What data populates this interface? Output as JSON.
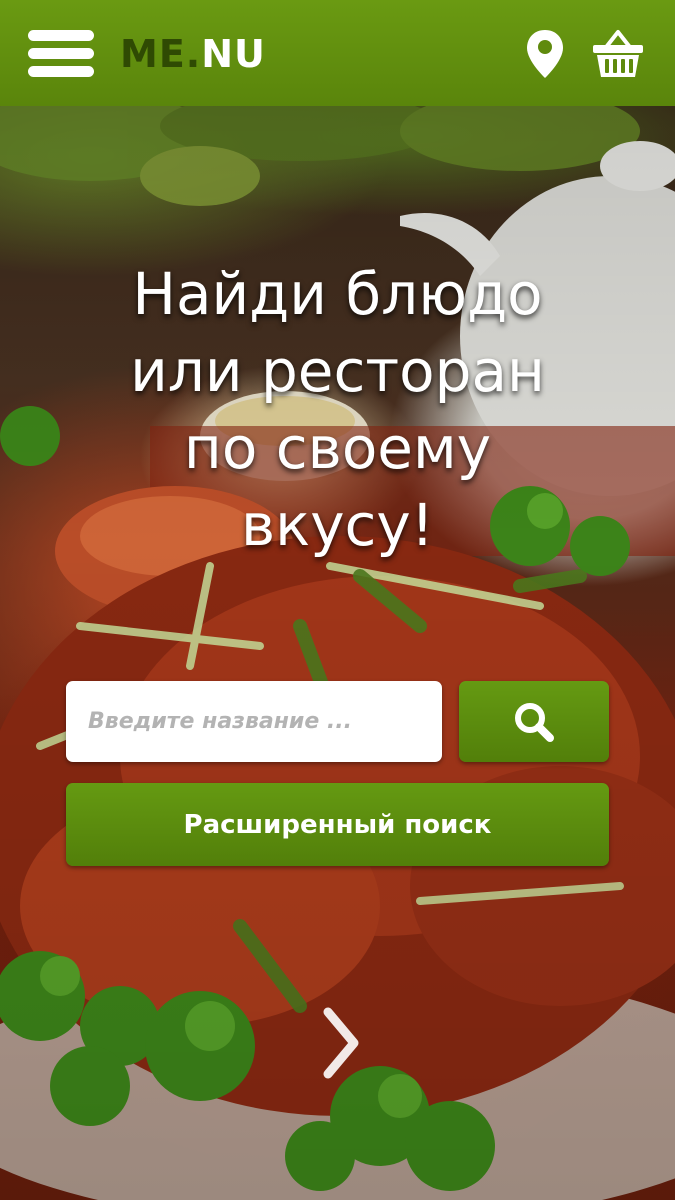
{
  "header": {
    "menu_icon": "hamburger-menu-icon",
    "logo_part1": "ME.",
    "logo_part2": "NU",
    "location_icon": "map-pin-icon",
    "cart_icon": "shopping-basket-icon",
    "background_color": "#5f8a0d"
  },
  "hero": {
    "headline_line1": "Найди блюдо",
    "headline_line2": "или ресторан",
    "headline_line3": "по своему",
    "headline_line4": "вкусу!",
    "search_placeholder": "Введите название ...",
    "search_icon": "search-icon",
    "advanced_search_label": "Расширенный поиск",
    "next_icon": "chevron-right-icon"
  },
  "colors": {
    "accent": "#5f8a0d",
    "logo_dark": "#2f4a03",
    "text_light": "#ffffff"
  }
}
